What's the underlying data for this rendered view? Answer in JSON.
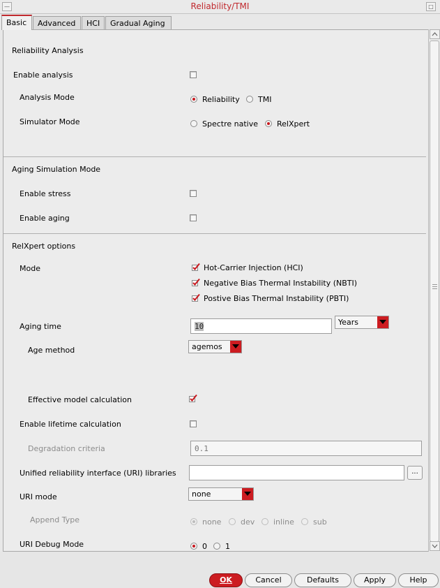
{
  "window": {
    "title": "Reliability/TMI",
    "menu_glyph": "—",
    "max_glyph": "□"
  },
  "tabs": [
    {
      "label": "Basic",
      "active": true
    },
    {
      "label": "Advanced"
    },
    {
      "label": "HCI"
    },
    {
      "label": "Gradual Aging"
    }
  ],
  "reliability_analysis": {
    "header": "Reliability Analysis",
    "enable_analysis": {
      "label": "Enable analysis",
      "checked": false
    },
    "analysis_mode": {
      "label": "Analysis Mode",
      "options": [
        "Reliability",
        "TMI"
      ],
      "selected": "Reliability"
    },
    "simulator_mode": {
      "label": "Simulator Mode",
      "options": [
        "Spectre native",
        "RelXpert"
      ],
      "selected": "RelXpert"
    }
  },
  "aging_simulation": {
    "header": "Aging Simulation Mode",
    "enable_stress": {
      "label": "Enable stress",
      "checked": false
    },
    "enable_aging": {
      "label": "Enable aging",
      "checked": false
    }
  },
  "relxpert": {
    "header": "RelXpert options",
    "mode_label": "Mode",
    "modes": [
      {
        "label": "Hot-Carrier Injection (HCI)",
        "checked": true
      },
      {
        "label": "Negative Bias Thermal Instability (NBTI)",
        "checked": true
      },
      {
        "label": "Postive Bias Thermal Instability (PBTI)",
        "checked": true
      }
    ],
    "aging_time": {
      "label": "Aging time",
      "value": "10",
      "unit": "Years"
    },
    "age_method": {
      "label": "Age method",
      "value": "agemos"
    },
    "effective_model": {
      "label": "Effective model calculation",
      "checked": true
    },
    "enable_lifetime": {
      "label": "Enable lifetime calculation",
      "checked": false
    },
    "degradation": {
      "label": "Degradation criteria",
      "value": "0.1"
    },
    "uri_libraries": {
      "label": "Unified reliability interface (URI) libraries",
      "value": "",
      "browse_label": "..."
    },
    "uri_mode": {
      "label": "URI mode",
      "value": "none"
    },
    "append_type": {
      "label": "Append Type",
      "options": [
        "none",
        "dev",
        "inline",
        "sub"
      ],
      "selected": "none"
    },
    "uri_debug": {
      "label": "URI Debug Mode",
      "options": [
        "0",
        "1"
      ],
      "selected": "0"
    }
  },
  "buttons": {
    "ok": "OK",
    "cancel": "Cancel",
    "defaults": "Defaults",
    "apply": "Apply",
    "help": "Help"
  },
  "colors": {
    "accent": "#cc1c21",
    "title": "#c0282d"
  }
}
